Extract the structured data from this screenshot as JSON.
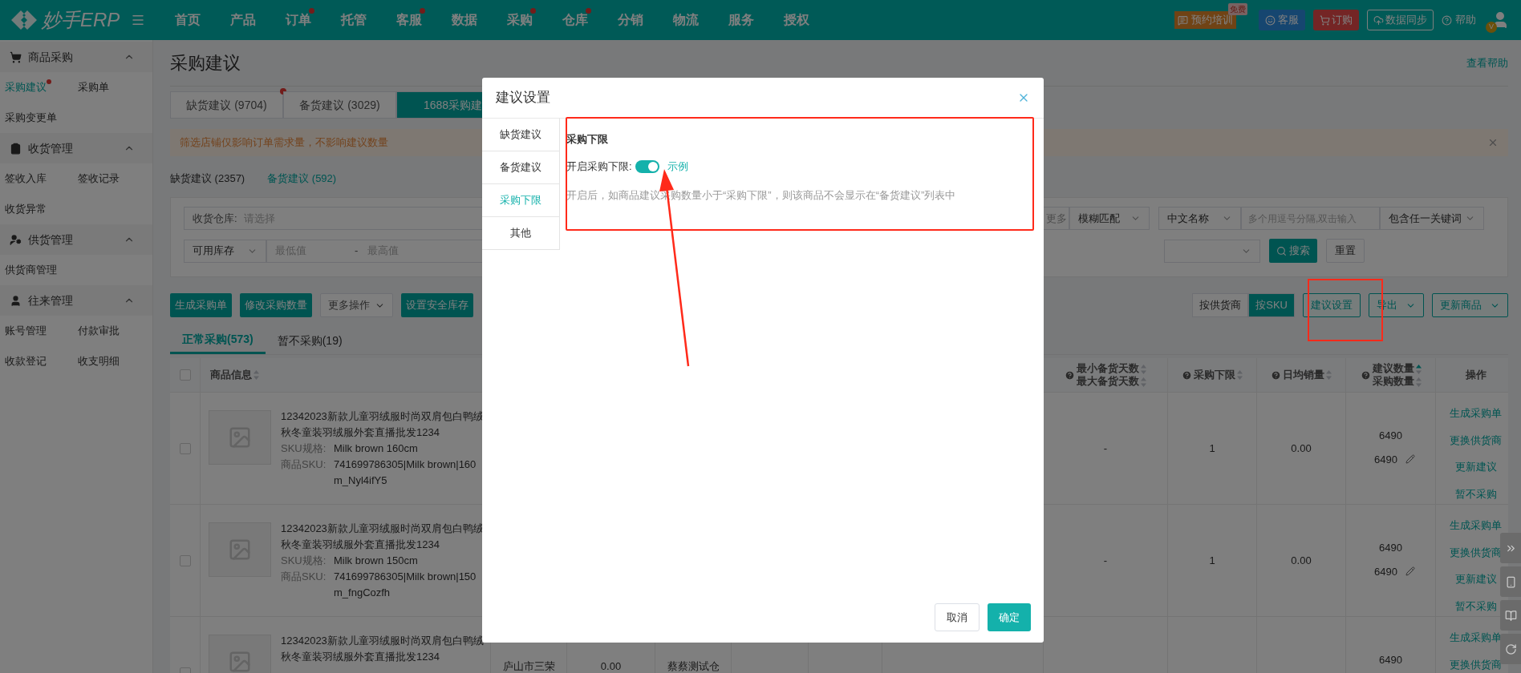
{
  "top_bar": {
    "logo": "妙手ERP",
    "nav": [
      {
        "label": "首页",
        "dot": false
      },
      {
        "label": "产品",
        "dot": false
      },
      {
        "label": "订单",
        "dot": true
      },
      {
        "label": "托管",
        "dot": false
      },
      {
        "label": "客服",
        "dot": true
      },
      {
        "label": "数据",
        "dot": false
      },
      {
        "label": "采购",
        "dot": true
      },
      {
        "label": "仓库",
        "dot": true
      },
      {
        "label": "分销",
        "dot": false
      },
      {
        "label": "物流",
        "dot": false
      },
      {
        "label": "服务",
        "dot": false
      },
      {
        "label": "授权",
        "dot": false
      }
    ],
    "training": "预约培训",
    "training_badge": "免费",
    "service": "客服",
    "order": "订购",
    "sync": "数据同步",
    "help": "帮助",
    "avatar_badge": "V"
  },
  "sidebar": {
    "groups": [
      {
        "title": "商品采购",
        "expanded": true,
        "items": [
          {
            "label": "采购建议",
            "selected": true,
            "dot": true
          },
          {
            "label": "采购单",
            "selected": false,
            "dot": false
          },
          {
            "label": "采购变更单",
            "selected": false,
            "dot": false
          }
        ]
      },
      {
        "title": "收货管理",
        "expanded": true,
        "items": [
          {
            "label": "签收入库",
            "selected": false,
            "dot": false
          },
          {
            "label": "签收记录",
            "selected": false,
            "dot": false
          },
          {
            "label": "收货异常",
            "selected": false,
            "dot": false
          }
        ]
      },
      {
        "title": "供货管理",
        "expanded": true,
        "items": [
          {
            "label": "供货商管理",
            "selected": false,
            "dot": false
          }
        ]
      },
      {
        "title": "往来管理",
        "expanded": true,
        "items": [
          {
            "label": "账号管理",
            "selected": false,
            "dot": false
          },
          {
            "label": "付款审批",
            "selected": false,
            "dot": false
          },
          {
            "label": "收款登记",
            "selected": false,
            "dot": false
          },
          {
            "label": "收支明细",
            "selected": false,
            "dot": false
          }
        ]
      }
    ]
  },
  "page": {
    "title": "采购建议",
    "help_link": "查看帮助",
    "tabs": [
      {
        "label": "缺货建议 (9704)",
        "selected": false,
        "dot": true
      },
      {
        "label": "备货建议 (3029)",
        "selected": false,
        "dot": false
      },
      {
        "label": "1688采购建",
        "selected": true,
        "dot": false
      }
    ],
    "notice": "筛选店铺仅影响订单需求量，不影响建议数量",
    "sub_tabs": [
      {
        "label": "缺货建议 (2357)",
        "selected": false
      },
      {
        "label": "备货建议 (592)",
        "selected": true
      }
    ],
    "filters": {
      "warehouse_label": "收货仓库:",
      "warehouse_placeholder": "请选择",
      "more": "更多",
      "match": "模糊匹配",
      "name_field": "中文名称",
      "keyword_placeholder": "多个用逗号分隔,双击输入",
      "keyword_mode": "包含任一关键词",
      "stock_field": "可用库存",
      "min_placeholder": "最低值",
      "range_sep": "-",
      "max_placeholder": "最高值",
      "search": "搜索",
      "reset": "重置"
    },
    "actions": [
      {
        "label": "生成采购单",
        "kind": "primary"
      },
      {
        "label": "修改采购数量",
        "kind": "primary"
      },
      {
        "label": "更多操作",
        "kind": "dropdown"
      },
      {
        "label": "设置安全库存",
        "kind": "primary"
      }
    ],
    "view_toggle": [
      {
        "label": "按供货商",
        "selected": false
      },
      {
        "label": "按SKU",
        "selected": true
      }
    ],
    "right_actions": [
      {
        "label": "建议设置",
        "kind": "outline"
      },
      {
        "label": "导出",
        "kind": "dropdown"
      },
      {
        "label": "更新商品",
        "kind": "dropdown"
      }
    ],
    "list_tabs": [
      {
        "label": "正常采购(573)",
        "selected": true
      },
      {
        "label": "暂不采购(19)",
        "selected": false
      }
    ],
    "table": {
      "select_all_checked": false,
      "columns": {
        "product": "商品信息",
        "days": [
          "最小备货天数",
          "最大备货天数"
        ],
        "lower_limit": "采购下限",
        "daily_sales": "日均销量",
        "quantity": [
          "建议数量",
          "采购数量"
        ],
        "ops": "操作"
      },
      "rows": [
        {
          "checked": false,
          "title_lines": [
            "12342023新款儿童羽绒服时尚双肩包白鸭绒",
            "秋冬童装羽绒服外套直播批发1234"
          ],
          "spec_label": "SKU规格:",
          "spec": "Milk brown 160cm",
          "sku_label": "商品SKU:",
          "sku_lines": [
            "741699786305|Milk brown|160",
            "m_Nyl4ifY5"
          ],
          "days": "-",
          "lower_limit": "1",
          "daily_sales": "0.00",
          "suggested": "6490",
          "purchase": "6490",
          "ops": [
            "生成采购单",
            "更换供货商",
            "更新建议",
            "暂不采购"
          ]
        },
        {
          "checked": false,
          "title_lines": [
            "12342023新款儿童羽绒服时尚双肩包白鸭绒",
            "秋冬童装羽绒服外套直播批发1234"
          ],
          "spec_label": "SKU规格:",
          "spec": "Milk brown 150cm",
          "sku_label": "商品SKU:",
          "sku_lines": [
            "741699786305|Milk brown|150",
            "m_fngCozfh"
          ],
          "days": "-",
          "lower_limit": "1",
          "daily_sales": "0.00",
          "suggested": "6490",
          "purchase": "6490",
          "ops": [
            "生成采购单",
            "更换供货商",
            "更新建议",
            "暂不采购"
          ]
        },
        {
          "checked": false,
          "title_lines": [
            "12342023新款儿童羽绒服时尚双肩包白鸭绒",
            "秋冬童装羽绒服外套直播批发1234"
          ],
          "supplier": "庐山市三荣",
          "price": "0.00",
          "warehouse": "蔡蔡测试仓",
          "suggested": "6490",
          "ops": [
            "生成采购单",
            "更换供货商"
          ]
        }
      ]
    }
  },
  "modal": {
    "title": "建议设置",
    "menu": [
      {
        "label": "缺货建议",
        "selected": false
      },
      {
        "label": "备货建议",
        "selected": false
      },
      {
        "label": "采购下限",
        "selected": true
      },
      {
        "label": "其他",
        "selected": false
      }
    ],
    "section_title": "采购下限",
    "toggle": {
      "label": "开启采购下限:",
      "on": true
    },
    "example_link": "示例",
    "description": "开启后，如商品建议采购数量小于“采购下限”，则该商品不会显示在“备货建议”列表中",
    "buttons": [
      {
        "label": "取消",
        "kind": "default"
      },
      {
        "label": "确定",
        "kind": "primary"
      }
    ]
  }
}
